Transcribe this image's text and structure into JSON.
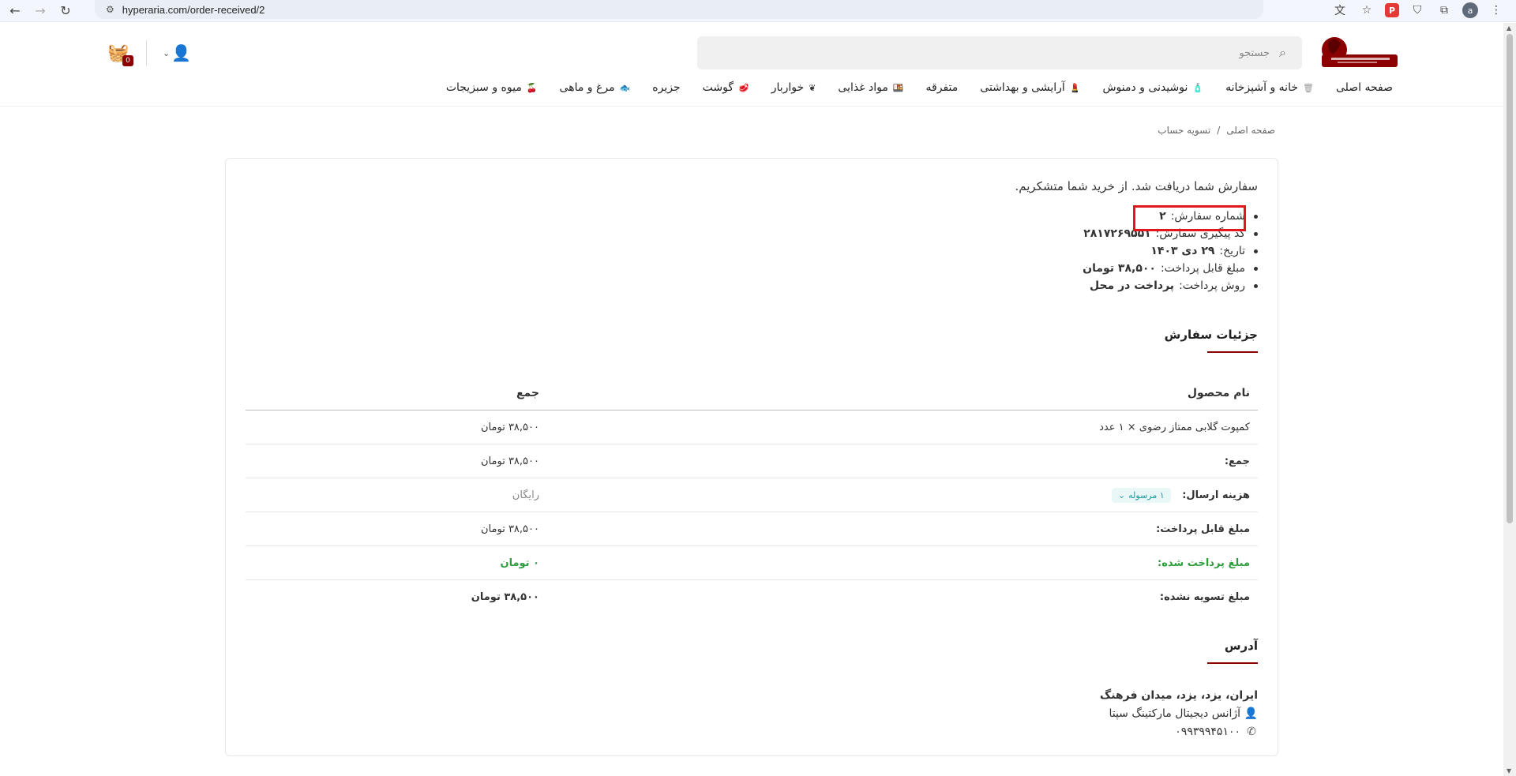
{
  "browser": {
    "url": "hyperaria.com/order-received/2",
    "profile_initial": "a"
  },
  "search": {
    "placeholder": "جستجو"
  },
  "cart": {
    "count": "0"
  },
  "nav": [
    {
      "label": "صفحه اصلی",
      "icon": "home-icon"
    },
    {
      "label": "خانه و آشپزخانه",
      "icon": "trash-icon"
    },
    {
      "label": "نوشیدنی و دمنوش",
      "icon": "bottle-icon"
    },
    {
      "label": "آرایشی و بهداشتی",
      "icon": "cosmetic-icon"
    },
    {
      "label": "متفرقه",
      "icon": ""
    },
    {
      "label": "مواد غذایی",
      "icon": "food-icon"
    },
    {
      "label": "خواربار",
      "icon": "grain-icon"
    },
    {
      "label": "گوشت",
      "icon": "meat-icon"
    },
    {
      "label": "جزیره",
      "icon": ""
    },
    {
      "label": "مرغ و ماهی",
      "icon": "fish-icon"
    },
    {
      "label": "میوه و سبزیجات",
      "icon": "fruit-icon"
    }
  ],
  "breadcrumb": {
    "home": "صفحه اصلی",
    "separator": "/",
    "current": "تسویه حساب"
  },
  "order": {
    "thanks": "سفارش شما دریافت شد. از خرید شما متشکریم.",
    "items": [
      {
        "label": "شماره سفارش:",
        "value": "۲"
      },
      {
        "label": "کد پیگیری سفارش:",
        "value": "۲۸۱۷۲۶۹۵۵۱"
      },
      {
        "label": "تاریخ:",
        "value": "۲۹ دی ۱۴۰۳"
      },
      {
        "label": "مبلغ قابل پرداخت:",
        "value": "۳۸,۵۰۰ تومان"
      },
      {
        "label": "روش پرداخت:",
        "value": "پرداخت در محل"
      }
    ]
  },
  "details": {
    "title": "جزئیات سفارش",
    "header_product": "نام محصول",
    "header_total": "جمع",
    "product_name": "کمپوت گلابی ممتاز رضوی × ۱ عدد",
    "product_total": "۳۸,۵۰۰ تومان",
    "subtotal_label": "جمع:",
    "subtotal_value": "۳۸,۵۰۰ تومان",
    "shipping_label": "هزینه ارسال:",
    "shipping_tag": "۱ مرسوله",
    "shipping_value": "رایگان",
    "payable_label": "مبلغ قابل پرداخت:",
    "payable_value": "۳۸,۵۰۰ تومان",
    "paid_label": "مبلغ پرداخت شده:",
    "paid_value": "۰ تومان",
    "unpaid_label": "مبلغ تسویه نشده:",
    "unpaid_value": "۳۸,۵۰۰ تومان"
  },
  "address": {
    "title": "آدرس",
    "location": "ایران، یزد، یزد، میدان فرهنگ",
    "name": "آژانس دیجیتال مارکتینگ سپتا",
    "phone": "۰۹۹۳۹۹۴۵۱۰۰"
  }
}
